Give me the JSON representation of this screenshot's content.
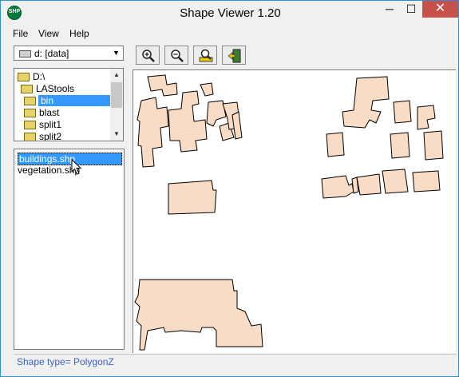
{
  "window": {
    "title": "Shape Viewer 1.20",
    "icon_label": "SHP",
    "controls": {
      "minimize": "─",
      "maximize": "☐",
      "close": "✕"
    }
  },
  "menu": {
    "file": "File",
    "view": "View",
    "help": "Help"
  },
  "drive_select": {
    "value": "d: [data]",
    "icon": "drive-icon"
  },
  "directories": [
    {
      "label": "D:\\"
    },
    {
      "label": "LAStools"
    },
    {
      "label": "bin",
      "selected": true
    },
    {
      "label": "blast"
    },
    {
      "label": "split1"
    },
    {
      "label": "split2"
    }
  ],
  "files": [
    {
      "label": "buildings.shp",
      "selected": true
    },
    {
      "label": "vegetation.shp"
    }
  ],
  "toolbar": [
    {
      "name": "zoom-in-button",
      "icon": "zoom-in-icon"
    },
    {
      "name": "zoom-out-button",
      "icon": "zoom-out-icon"
    },
    {
      "name": "zoom-extent-button",
      "icon": "zoom-extent-icon"
    },
    {
      "name": "exit-button",
      "icon": "exit-door-icon"
    }
  ],
  "status": {
    "text": "Shape type= PolygonZ"
  },
  "colors": {
    "polygon_fill": "#f9dcc6",
    "polygon_stroke": "#000000",
    "selection": "#3399ff",
    "close_button": "#c7504a",
    "status_text": "#3a64c8"
  }
}
